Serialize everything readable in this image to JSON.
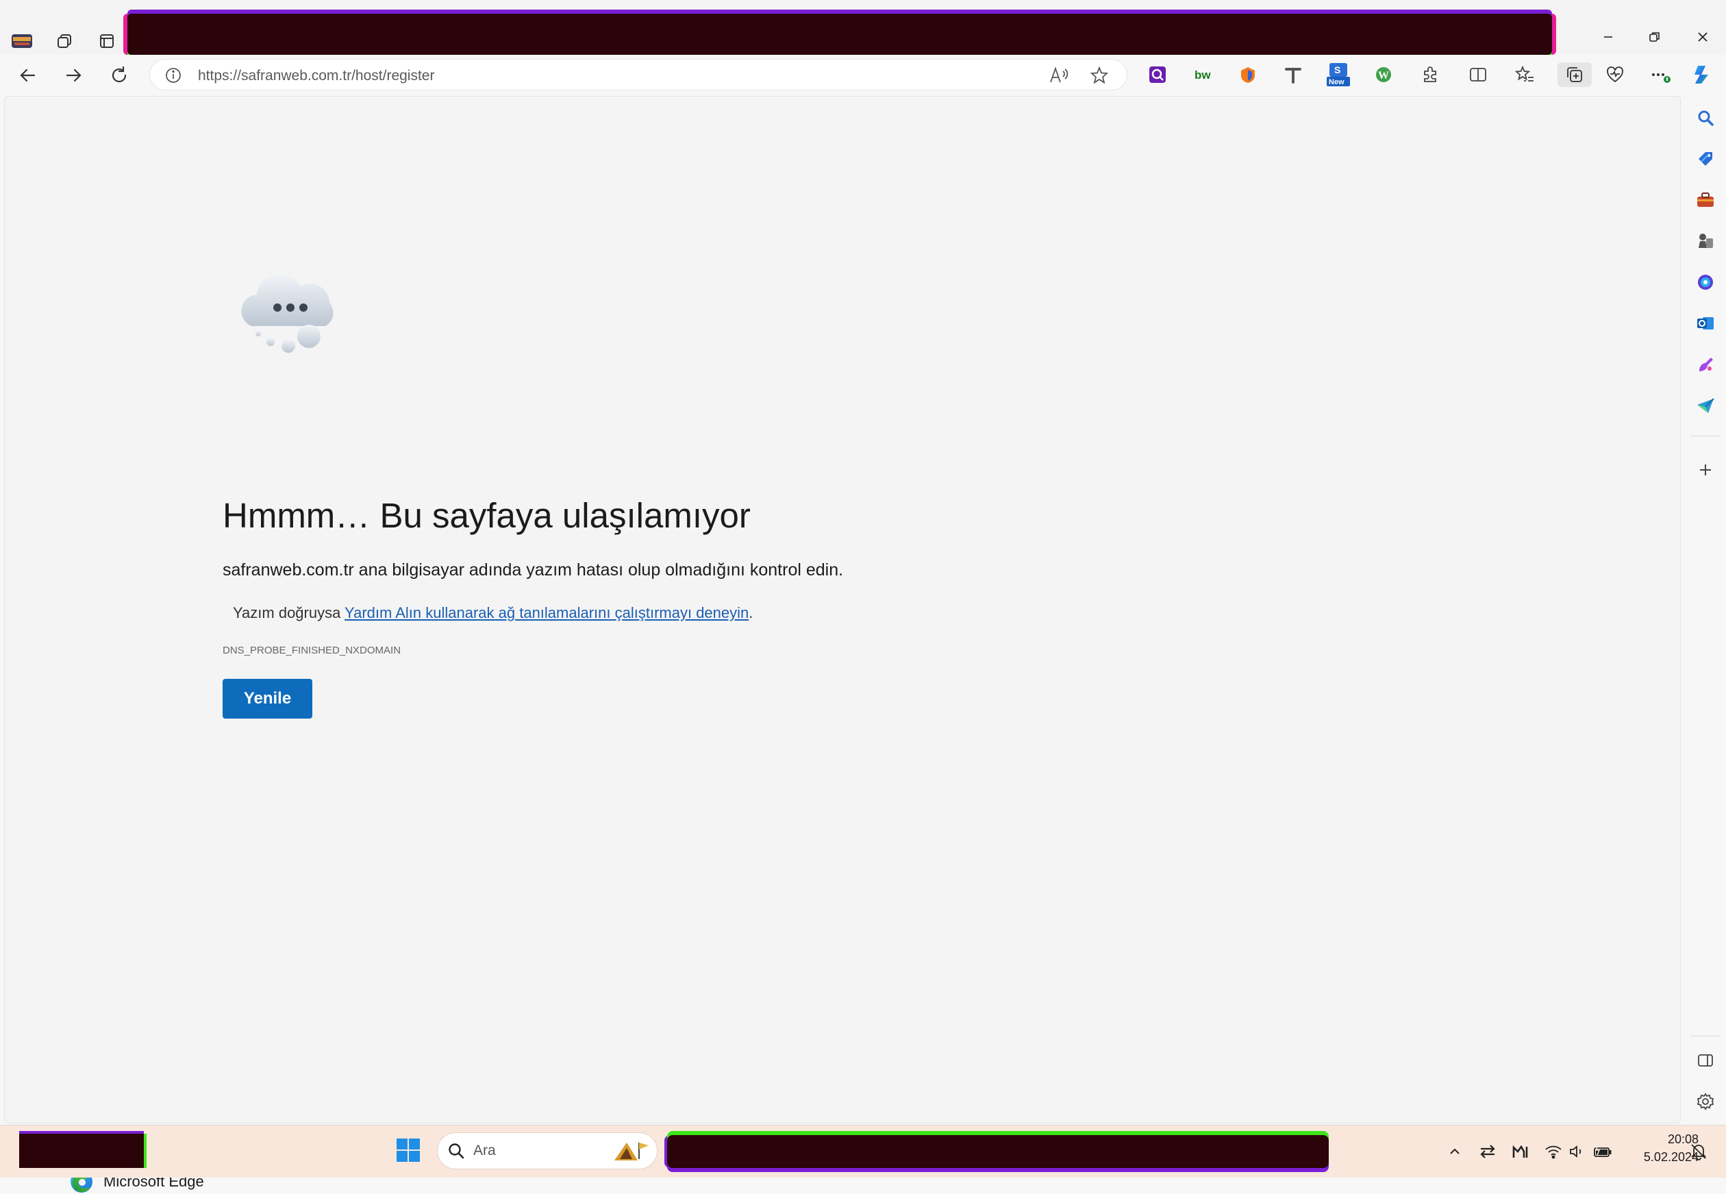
{
  "browser": {
    "url": "https://safranweb.com.tr/host/register",
    "sidebar_items": [
      "search-icon",
      "tag-icon",
      "briefcase-icon",
      "chess-icon",
      "copilot-icon",
      "outlook-icon",
      "designer-icon",
      "send-icon",
      "add-icon",
      "sidebar-toggle-icon",
      "settings-icon"
    ],
    "extensions": {
      "new_badge": "New"
    }
  },
  "error_page": {
    "title": "Hmmm… Bu sayfaya ulaşılamıyor",
    "description": "safranweb.com.tr ana bilgisayar adında yazım hatası olup olmadığını kontrol edin.",
    "hint_prefix": "Yazım doğruysa ",
    "hint_link": "Yardım Alın kullanarak ağ tanılamalarını çalıştırmayı deneyin",
    "hint_suffix": ".",
    "error_code": "DNS_PROBE_FINISHED_NXDOMAIN",
    "reload_label": "Yenile",
    "brand": "Microsoft Edge"
  },
  "taskbar": {
    "search_placeholder": "Ara",
    "time": "20:08",
    "date": "5.02.2024"
  },
  "colors": {
    "accent": "#0f6cbd",
    "link": "#1a5fb4",
    "taskbar_bg": "#f9e7dc"
  }
}
